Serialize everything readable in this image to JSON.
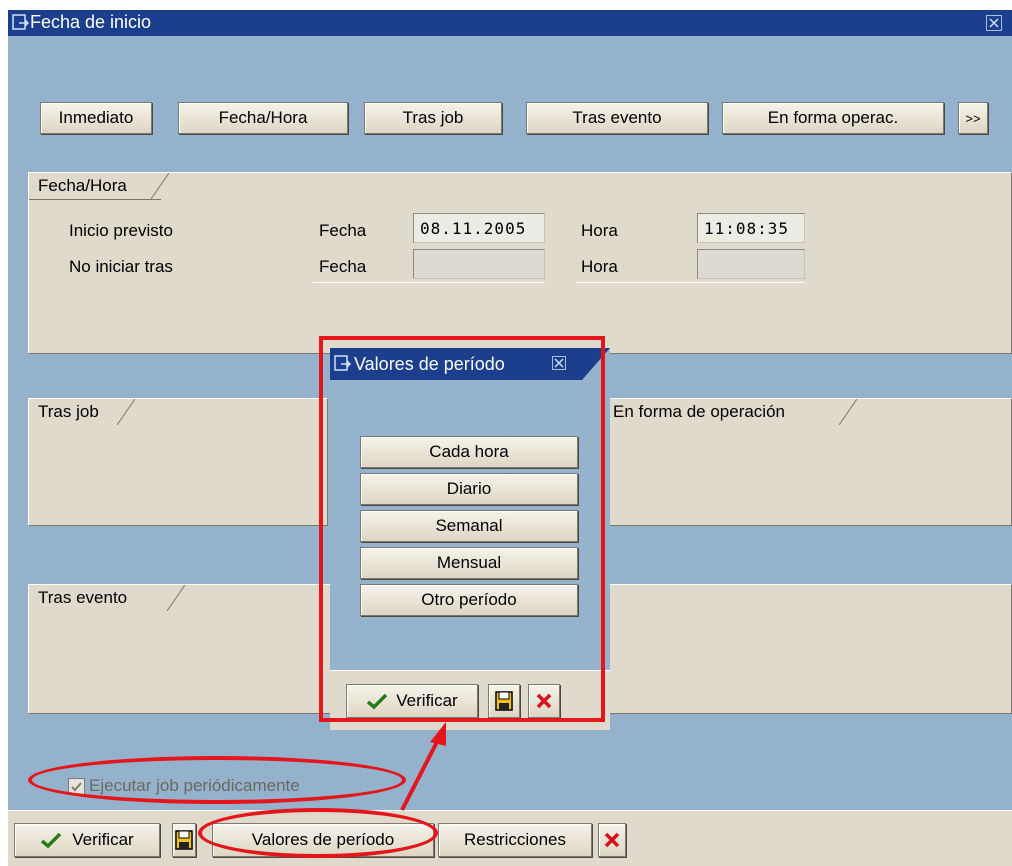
{
  "window": {
    "title": "Fecha de inicio"
  },
  "toolbar": {
    "immediate": "Inmediato",
    "date_time": "Fecha/Hora",
    "after_job": "Tras job",
    "after_event": "Tras evento",
    "operation_mode": "En forma operac.",
    "more": ">>"
  },
  "date_time_group": {
    "tab": "Fecha/Hora",
    "planned_start": "Inicio previsto",
    "no_start_after": "No iniciar tras",
    "date_label": "Fecha",
    "time_label": "Hora",
    "planned_date": "08.11.2005",
    "planned_time": "11:08:35",
    "no_start_date": "",
    "no_start_time": ""
  },
  "after_job_group": {
    "tab": "Tras job"
  },
  "operation_mode_group": {
    "tab": "En forma de operación"
  },
  "after_event_group": {
    "tab": "Tras evento"
  },
  "periodic": {
    "label": "Ejecutar job periódicamente",
    "checked": true
  },
  "period_popup": {
    "title": "Valores de período",
    "options": [
      "Cada hora",
      "Diario",
      "Semanal",
      "Mensual",
      "Otro período"
    ],
    "verify": "Verificar"
  },
  "bottom_bar": {
    "verify": "Verificar",
    "period_values": "Valores de período",
    "restrictions": "Restricciones"
  },
  "colors": {
    "title_bar": "#1b3f8c",
    "background": "#94b2cb",
    "group_fill": "#dfdacb",
    "annotation_red": "#e4151b"
  }
}
